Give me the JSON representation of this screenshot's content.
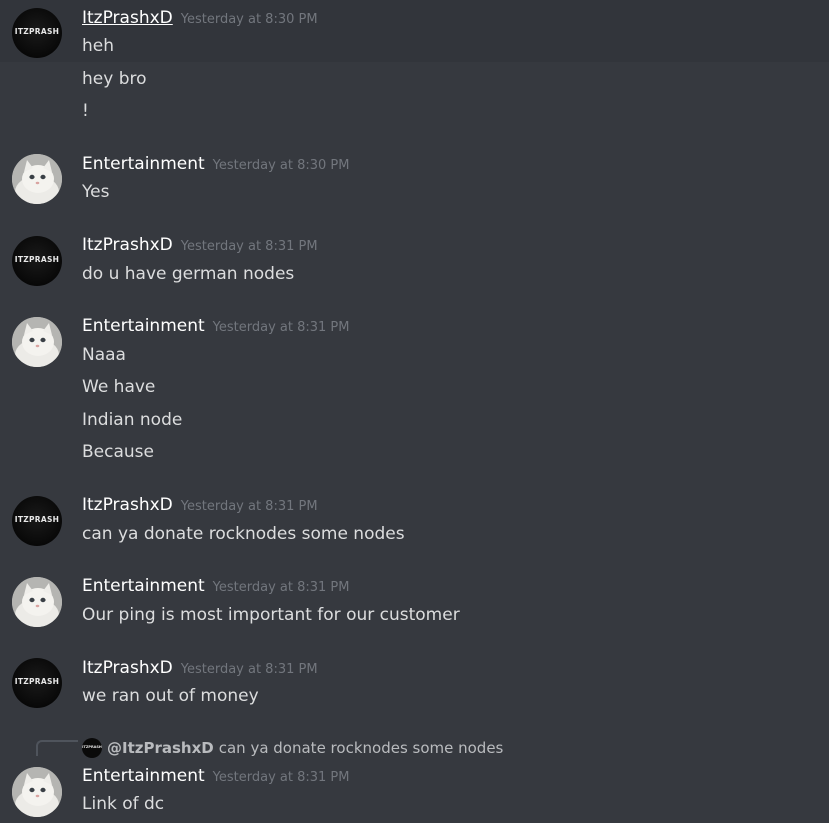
{
  "messages": [
    {
      "author": "ItzPrashxD",
      "avatar_label": "ITZPRASH",
      "timestamp": "Yesterday at 8:30 PM",
      "lines": [
        "heh",
        "hey bro",
        "!"
      ]
    },
    {
      "author": "Entertainment",
      "timestamp": "Yesterday at 8:30 PM",
      "lines": [
        "Yes"
      ]
    },
    {
      "author": "ItzPrashxD",
      "avatar_label": "ITZPRASH",
      "timestamp": "Yesterday at 8:31 PM",
      "lines": [
        "do u have german nodes"
      ]
    },
    {
      "author": "Entertainment",
      "timestamp": "Yesterday at 8:31 PM",
      "lines": [
        "Naaa",
        "We have",
        "Indian node",
        "Because"
      ]
    },
    {
      "author": "ItzPrashxD",
      "avatar_label": "ITZPRASH",
      "timestamp": "Yesterday at 8:31 PM",
      "lines": [
        "can ya donate rocknodes some nodes"
      ]
    },
    {
      "author": "Entertainment",
      "timestamp": "Yesterday at 8:31 PM",
      "lines": [
        "Our ping is most important for our customer"
      ]
    },
    {
      "author": "ItzPrashxD",
      "avatar_label": "ITZPRASH",
      "timestamp": "Yesterday at 8:31 PM",
      "lines": [
        "we ran out of money"
      ]
    },
    {
      "author": "Entertainment",
      "timestamp": "Yesterday at 8:31 PM",
      "lines": [
        "Link of dc"
      ],
      "reply": {
        "author": "@ItzPrashxD",
        "text": "can ya donate rocknodes some nodes"
      }
    }
  ],
  "colors": {
    "background": "#36393f",
    "hover_background": "#32353b",
    "username": "#ffffff",
    "timestamp": "#72767d",
    "message_text": "#dcddde",
    "reply_text": "#b9bbbe"
  },
  "icons": {
    "itz_avatar": "black-circle-avatar-with-text",
    "cat_avatar": "white-persian-cat-avatar",
    "reply_spine": "reply-connector-line"
  }
}
